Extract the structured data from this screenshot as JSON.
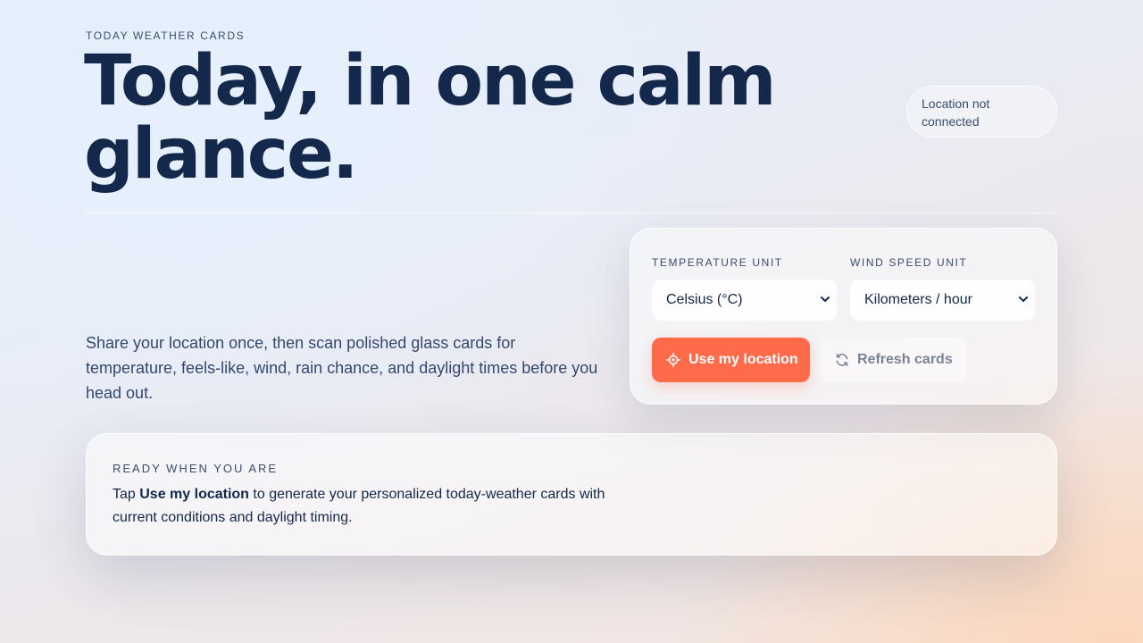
{
  "header": {
    "eyebrow": "TODAY WEATHER CARDS",
    "title_line1": "Today, in one calm",
    "title_line2": "glance.",
    "status": "Location not connected"
  },
  "intro": "Share your location once, then scan polished glass cards for temperature, feels-like, wind, rain chance, and daylight times before you head out.",
  "controls": {
    "temperature_label": "TEMPERATURE UNIT",
    "temperature_value": "Celsius (°C)",
    "wind_label": "WIND SPEED UNIT",
    "wind_value": "Kilometers / hour",
    "use_location": "Use my location",
    "refresh": "Refresh cards"
  },
  "ready": {
    "title": "READY WHEN YOU ARE",
    "text_prefix": "Tap ",
    "text_bold": "Use my location",
    "text_suffix": " to generate your personalized today-weather cards with current conditions and daylight timing."
  },
  "icons": {
    "use_location": "crosshair-icon",
    "refresh": "refresh-icon",
    "select": "chevron-down-icon"
  },
  "colors": {
    "accent": "#fe6b4a",
    "heading": "#13284b",
    "muted": "#3a4d6e"
  }
}
